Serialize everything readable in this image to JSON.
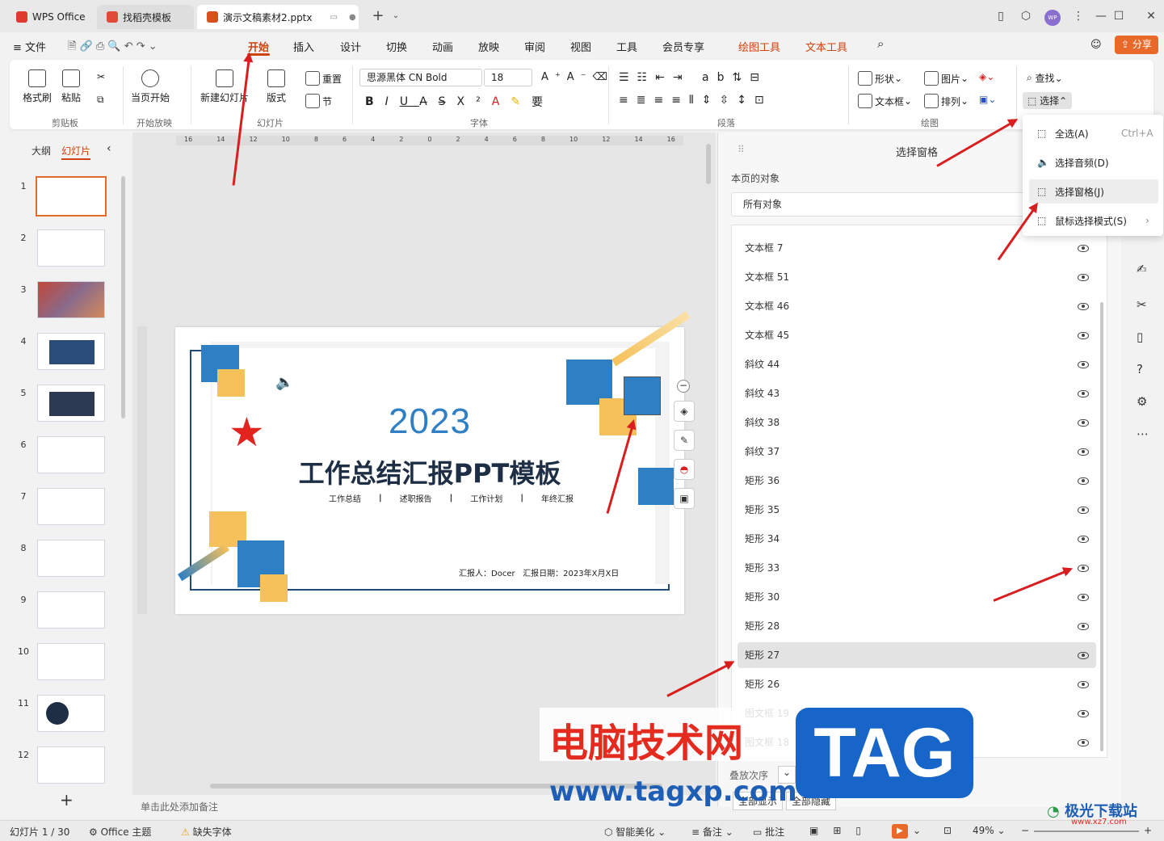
{
  "titlebar": {
    "tabs": [
      "WPS Office",
      "找稻壳模板",
      "演示文稿素材2.pptx"
    ],
    "add_tab": "+"
  },
  "menubar": {
    "file": "文件",
    "items": [
      "开始",
      "插入",
      "设计",
      "切换",
      "动画",
      "放映",
      "审阅",
      "视图",
      "工具",
      "会员专享",
      "绘图工具",
      "文本工具"
    ],
    "share": "分享"
  },
  "ribbon": {
    "clipboard": {
      "format_painter": "格式刷",
      "paste": "粘贴",
      "label": "剪贴板"
    },
    "play": {
      "from_current": "当页开始",
      "label": "开始放映"
    },
    "slides": {
      "new": "新建幻灯片",
      "layout": "版式",
      "reset": "重置",
      "section": "节",
      "label": "幻灯片"
    },
    "font": {
      "name": "思源黑体 CN Bold",
      "size": "18",
      "label": "字体"
    },
    "paragraph": {
      "label": "段落"
    },
    "drawing": {
      "shape": "形状",
      "picture": "图片",
      "textbox": "文本框",
      "arrange": "排列",
      "label": "绘图"
    },
    "find": "查找",
    "select": "选择"
  },
  "left": {
    "outline": "大纲",
    "slides": "幻灯片",
    "numbers": [
      "1",
      "2",
      "3",
      "4",
      "5",
      "6",
      "7",
      "8",
      "9",
      "10",
      "11",
      "12"
    ]
  },
  "slide": {
    "year": "2023",
    "title": "工作总结汇报PPT模板",
    "subs": [
      "工作总结",
      "述职报告",
      "工作计划",
      "年终汇报"
    ],
    "reporter": "汇报人：Docer",
    "date": "汇报日期：2023年X月X日"
  },
  "ruler": {
    "marks": [
      "16",
      "14",
      "12",
      "10",
      "8",
      "6",
      "4",
      "2",
      "0",
      "2",
      "4",
      "6",
      "8",
      "10",
      "12",
      "14",
      "16"
    ]
  },
  "notes": "单击此处添加备注",
  "pane": {
    "title": "选择窗格",
    "section": "本页的对象",
    "filter": "所有对象",
    "objects": [
      "文本框 7",
      "文本框 51",
      "文本框 46",
      "文本框 45",
      "斜纹 44",
      "斜纹 43",
      "斜纹 38",
      "斜纹 37",
      "矩形 36",
      "矩形 35",
      "矩形 34",
      "矩形 33",
      "矩形 30",
      "矩形 28",
      "矩形 27",
      "矩形 26",
      "图文框 19",
      "图文框 18"
    ],
    "order": "叠放次序",
    "show_all": "全部显示",
    "hide_all": "全部隐藏"
  },
  "dropdown": {
    "items": [
      "全选(A)",
      "选择音频(D)",
      "选择窗格(J)",
      "鼠标选择模式(S)"
    ],
    "shortcut": "Ctrl+A"
  },
  "status": {
    "slide": "幻灯片 1 / 30",
    "theme": "Office 主题",
    "font": "缺失字体",
    "beautify": "智能美化",
    "notes": "备注",
    "comment": "批注",
    "zoom": "49%"
  },
  "watermark": {
    "site": "电脑技术网",
    "url": "www.tagxp.com",
    "tag": "TAG",
    "logo": "极光下载站",
    "logo_url": "www.xz7.com"
  }
}
